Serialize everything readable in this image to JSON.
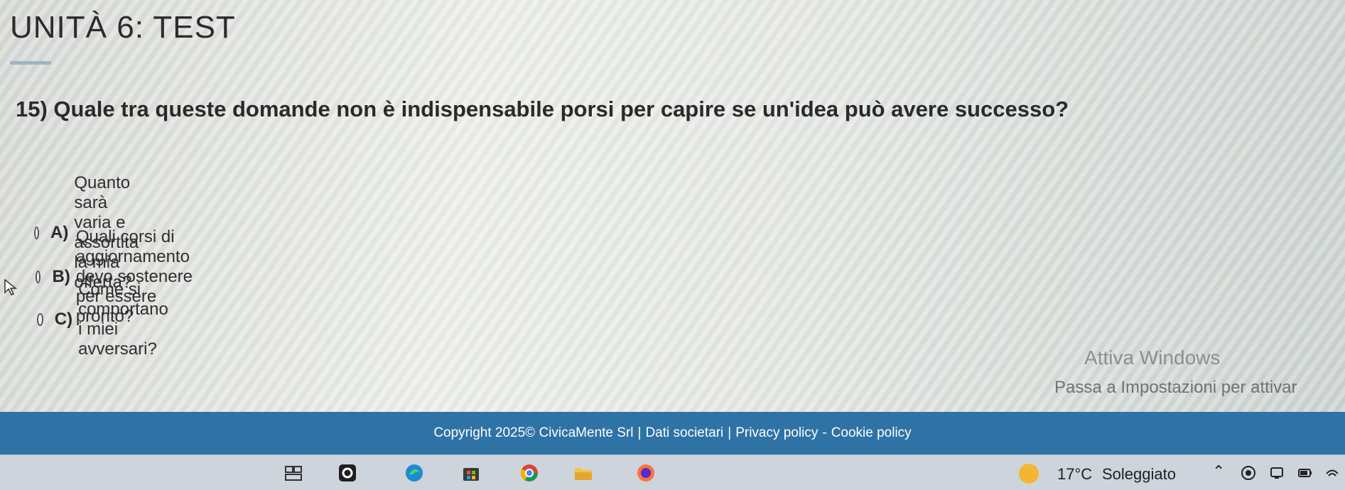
{
  "page": {
    "title": "UNITÀ 6: TEST",
    "question": "15) Quale tra queste domande non è indispensabile porsi per capire se un'idea può avere successo?",
    "options": [
      {
        "letter": "A)",
        "text": "Quanto sarà varia e assortita la mia offerta?"
      },
      {
        "letter": "B)",
        "text": "Quali corsi di aggiornamento devo sostenere per essere pronto?"
      },
      {
        "letter": "C)",
        "text": "Come si comportano i miei avversari?"
      }
    ]
  },
  "watermark": {
    "title": "Attiva Windows",
    "subtitle": "Passa a Impostazioni per attivar"
  },
  "footer": {
    "copyright": "Copyright 2025© CivicaMente Srl",
    "link1": "Dati societari",
    "link2": "Privacy policy",
    "link3": "Cookie policy",
    "sep": "|",
    "dash": "-"
  },
  "taskbar": {
    "temperature": "17°C",
    "weather": "Soleggiato",
    "icons": [
      "task-view-icon",
      "office-icon",
      "edge-icon",
      "store-icon",
      "chrome-icon",
      "file-explorer-icon",
      "firefox-icon"
    ]
  },
  "colors": {
    "footer_bg": "#2f72a6",
    "taskbar_bg": "#cdd4dc"
  }
}
